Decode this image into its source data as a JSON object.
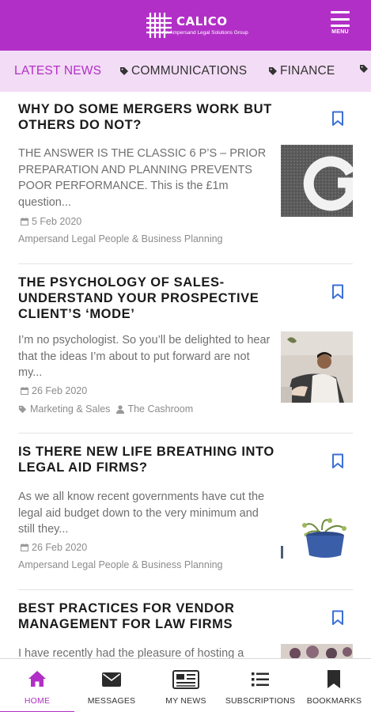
{
  "header": {
    "brand_name": "CALICO",
    "brand_subtitle": "An Ampersand Legal Solutions Group",
    "menu_label": "MENU",
    "color": "#b22fc7"
  },
  "tabs": [
    {
      "label": "LATEST NEWS",
      "active": true
    },
    {
      "label": "COMMUNICATIONS",
      "active": false
    },
    {
      "label": "FINANCE",
      "active": false
    }
  ],
  "articles": [
    {
      "title": "WHY DO SOME MERGERS WORK BUT OTHERS DO NOT?",
      "excerpt": "THE ANSWER IS THE CLASSIC 6 P’S – PRIOR PREPARATION AND PLANNING PREVENTS POOR PERFORMANCE. This is the £1m question...",
      "date": "5 Feb 2020",
      "author": "Ampersand Legal People & Business Planning"
    },
    {
      "title": "THE PSYCHOLOGY OF SALES- UNDERSTAND YOUR PROSPECTIVE CLIENT’S ‘MODE’",
      "excerpt": "I’m no psychologist. So you’ll be delighted to hear that the ideas I’m about to put forward are not my...",
      "date": "26 Feb 2020",
      "category": "Marketing & Sales",
      "author": "The Cashroom"
    },
    {
      "title": "IS THERE NEW LIFE BREATHING INTO LEGAL AID FIRMS?",
      "excerpt": "As we all know recent governments have cut the legal aid budget down to the very minimum and still they...",
      "date": "26 Feb 2020",
      "author": "Ampersand Legal People & Business Planning"
    },
    {
      "title": "BEST PRACTICES FOR VENDOR MANAGEMENT FOR LAW FIRMS",
      "excerpt": "I have recently had the pleasure of hosting a"
    }
  ],
  "bottom_nav": [
    {
      "label": "HOME",
      "icon": "home-icon",
      "active": true
    },
    {
      "label": "MESSAGES",
      "icon": "envelope-icon",
      "active": false
    },
    {
      "label": "MY NEWS",
      "icon": "newspaper-icon",
      "active": false
    },
    {
      "label": "SUBSCRIPTIONS",
      "icon": "list-icon",
      "active": false
    },
    {
      "label": "BOOKMARKS",
      "icon": "bookmark-icon",
      "active": false
    }
  ],
  "colors": {
    "accent": "#b22fc7",
    "tab_bar_bg": "#f3dcf5",
    "bookmark": "#3b6fd6"
  }
}
